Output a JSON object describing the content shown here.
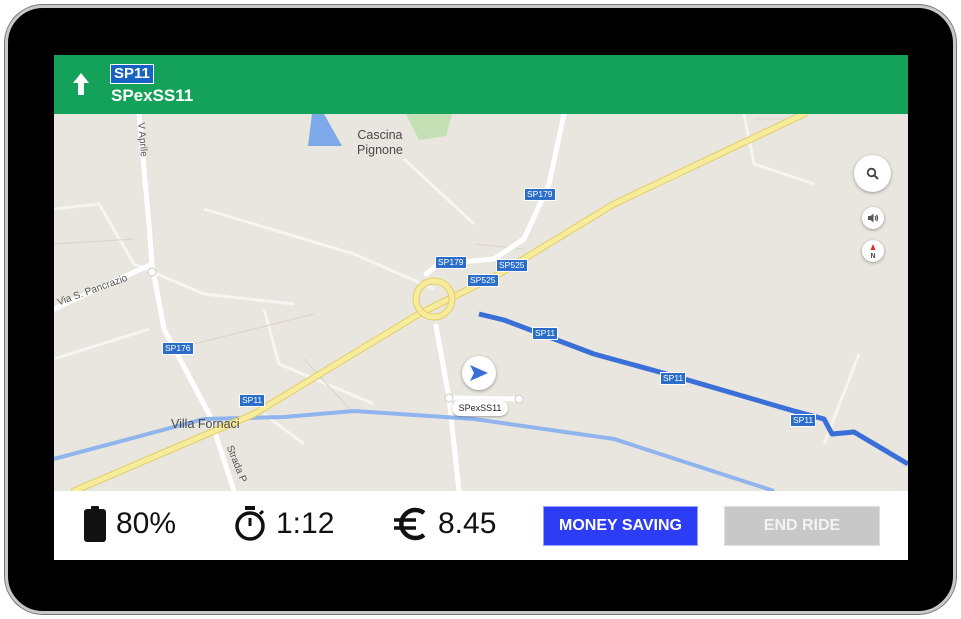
{
  "navigation": {
    "direction_icon": "arrow-up-icon",
    "route_badge": "SP11",
    "street": "SPexSS11"
  },
  "map": {
    "labels": {
      "cascina_line1": "Cascina",
      "cascina_line2": "Pignone",
      "villa_fornaci": "Villa Fornaci",
      "via_s_pancrazio": "Via S. Pancrazio",
      "v_aprile": "V Aprile",
      "strada_p": "Strada P"
    },
    "shields": {
      "sp179_a": "SP179",
      "sp179_b": "SP179",
      "sp525_a": "SP525",
      "sp525_b": "SP525",
      "sp176": "SP176",
      "sp11_a": "SP11",
      "sp11_b": "SP11",
      "sp11_c": "SP11",
      "sp11_d": "SP11"
    },
    "position_label": "SPexSS11",
    "controls": {
      "search_icon": "search-icon",
      "sound_icon": "speaker-icon",
      "compass_icon": "compass-icon",
      "compass_letter": "N"
    },
    "colors": {
      "route": "#3b6fd8",
      "highway": "#f4e38a",
      "water": "#7ea9e8"
    }
  },
  "status": {
    "battery_icon": "battery-icon",
    "battery": "80%",
    "timer_icon": "stopwatch-icon",
    "time": "1:12",
    "currency_icon": "euro-icon",
    "cost": "8.45",
    "money_saving_label": "MONEY SAVING",
    "end_ride_label": "END RIDE"
  },
  "colors": {
    "header": "#14a15a",
    "money_saving": "#2d3cf5",
    "end_ride": "#c8c8c8"
  }
}
